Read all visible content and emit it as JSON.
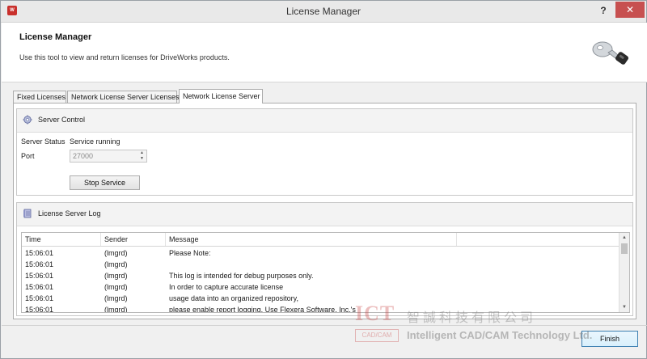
{
  "window": {
    "title": "License Manager",
    "icon_label": "W",
    "help_label": "?",
    "close_label": "✕"
  },
  "header": {
    "title": "License Manager",
    "description": "Use this tool to view and return licenses for DriveWorks products.",
    "icon": "license-key-icon"
  },
  "tabs": [
    {
      "label": "Fixed Licenses",
      "active": false
    },
    {
      "label": "Network License Server Licenses",
      "active": false
    },
    {
      "label": "Network License Server",
      "active": true
    }
  ],
  "server_control": {
    "title": "Server Control",
    "icon": "gear-icon",
    "status_label": "Server Status",
    "status_value": "Service running",
    "port_label": "Port",
    "port_value": "27000",
    "spinner_up": "▲",
    "spinner_down": "▼",
    "stop_button": "Stop Service"
  },
  "log": {
    "title": "License Server Log",
    "icon": "log-icon",
    "columns": [
      "Time",
      "Sender",
      "Message"
    ],
    "rows": [
      {
        "time": "15:06:01",
        "sender": "(lmgrd)",
        "message": "Please Note:"
      },
      {
        "time": "15:06:01",
        "sender": "(lmgrd)",
        "message": ""
      },
      {
        "time": "15:06:01",
        "sender": "(lmgrd)",
        "message": "This log is intended for debug purposes only."
      },
      {
        "time": "15:06:01",
        "sender": "(lmgrd)",
        "message": "In order to capture accurate license"
      },
      {
        "time": "15:06:01",
        "sender": "(lmgrd)",
        "message": "usage data into an organized repository,"
      },
      {
        "time": "15:06:01",
        "sender": "(lmgrd)",
        "message": "please enable report logging. Use Flexera Software, Inc.'s"
      }
    ],
    "scroll_up": "▲",
    "scroll_down": "▼"
  },
  "footer": {
    "finish_button": "Finish"
  },
  "watermark": {
    "ict": "ICT",
    "chinese": "智誠科技有限公司",
    "cadcam": "CAD/CAM",
    "english": "Intelligent CAD/CAM Technology Ltd."
  },
  "colors": {
    "window_bg": "#f0f0f0",
    "close_button": "#c75050",
    "accent_border": "#3c7fb1"
  }
}
